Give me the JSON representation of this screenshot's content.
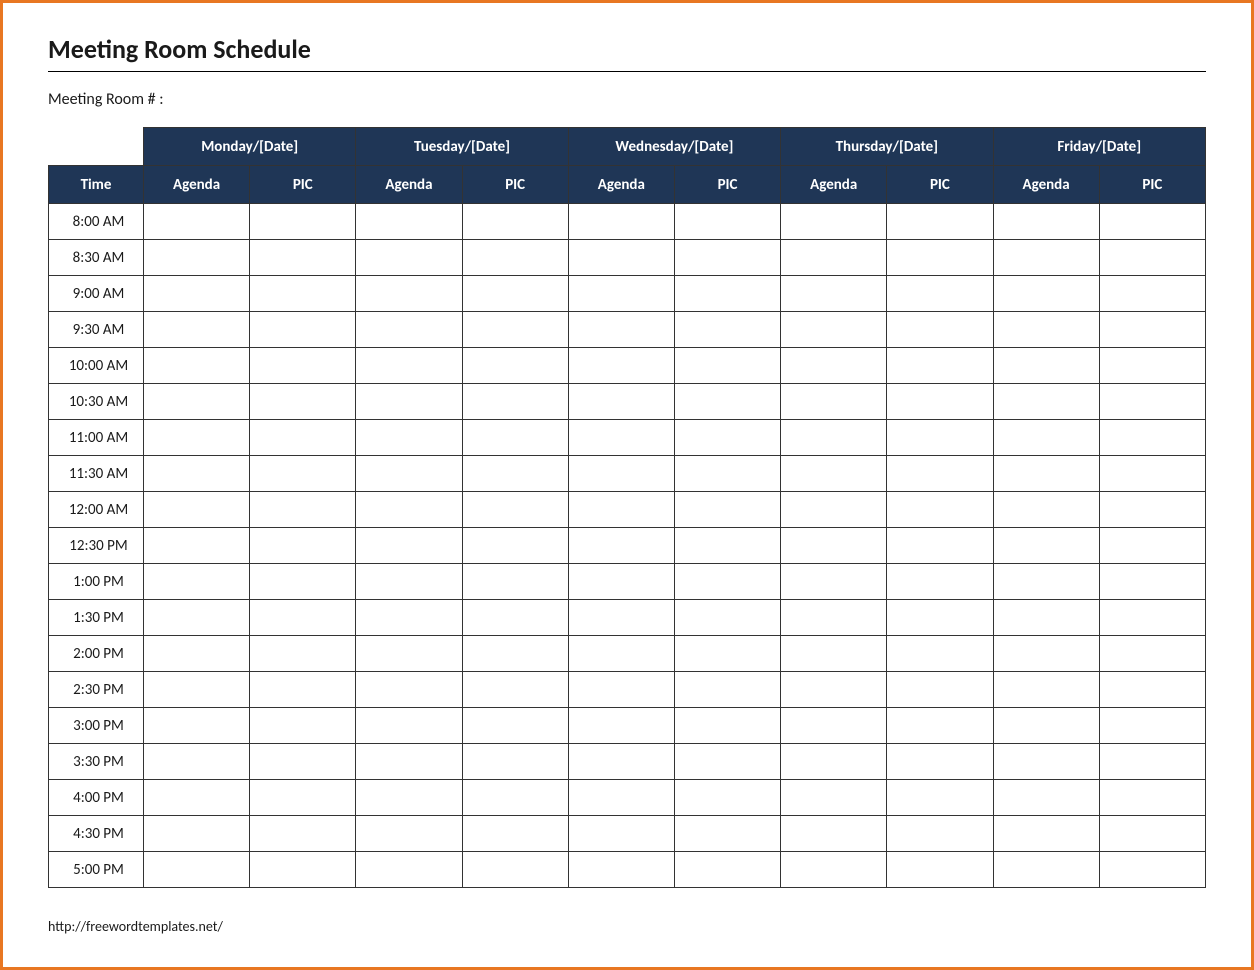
{
  "title": "Meeting Room Schedule",
  "room_label": "Meeting Room # :",
  "columns": {
    "time": "Time",
    "agenda": "Agenda",
    "pic": "PIC"
  },
  "days": [
    "Monday/[Date]",
    "Tuesday/[Date]",
    "Wednesday/[Date]",
    "Thursday/[Date]",
    "Friday/[Date]"
  ],
  "times": [
    "8:00 AM",
    "8:30 AM",
    "9:00 AM",
    "9:30 AM",
    "10:00 AM",
    "10:30 AM",
    "11:00 AM",
    "11:30 AM",
    "12:00 AM",
    "12:30 PM",
    "1:00 PM",
    "1:30 PM",
    "2:00 PM",
    "2:30 PM",
    "3:00 PM",
    "3:30 PM",
    "4:00 PM",
    "4:30 PM",
    "5:00 PM"
  ],
  "footer_url": "http://freewordtemplates.net/"
}
